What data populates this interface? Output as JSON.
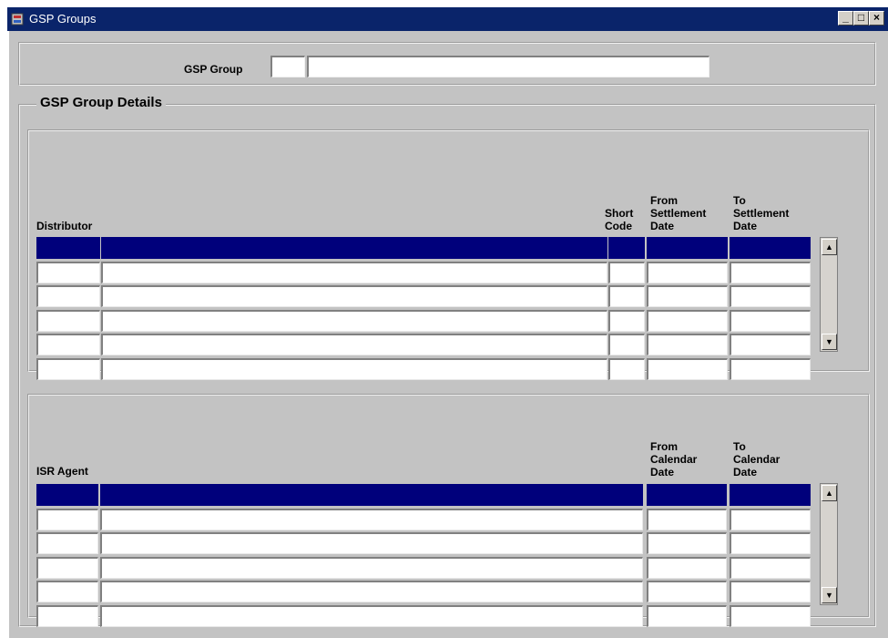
{
  "window": {
    "title": "GSP Groups",
    "minimize_glyph": "_",
    "maximize_glyph": "□",
    "close_glyph": "×"
  },
  "header": {
    "gsp_group_label": "GSP Group",
    "gsp_group_code": "",
    "gsp_group_name": ""
  },
  "details": {
    "title": "GSP Group Details"
  },
  "distributors": {
    "columns": {
      "distributor": "Distributor",
      "short_code_1": "Short",
      "short_code_2": "Code",
      "from_1": "From",
      "from_2": "Settlement",
      "from_3": "Date",
      "to_1": "To",
      "to_2": "Settlement",
      "to_3": "Date"
    },
    "row_count": 5
  },
  "isr_agents": {
    "columns": {
      "agent": "ISR Agent",
      "from_1": "From",
      "from_2": "Calendar",
      "from_3": "Date",
      "to_1": "To",
      "to_2": "Calendar",
      "to_3": "Date"
    },
    "row_count": 5
  },
  "scroll": {
    "up_glyph": "▲",
    "down_glyph": "▼"
  },
  "icons": [
    "app-icon",
    "scroll-up-icon",
    "scroll-down-icon"
  ],
  "colors": {
    "titlebar": "#0a246a",
    "selected_row": "#00007b",
    "background": "#c3c3c3"
  }
}
